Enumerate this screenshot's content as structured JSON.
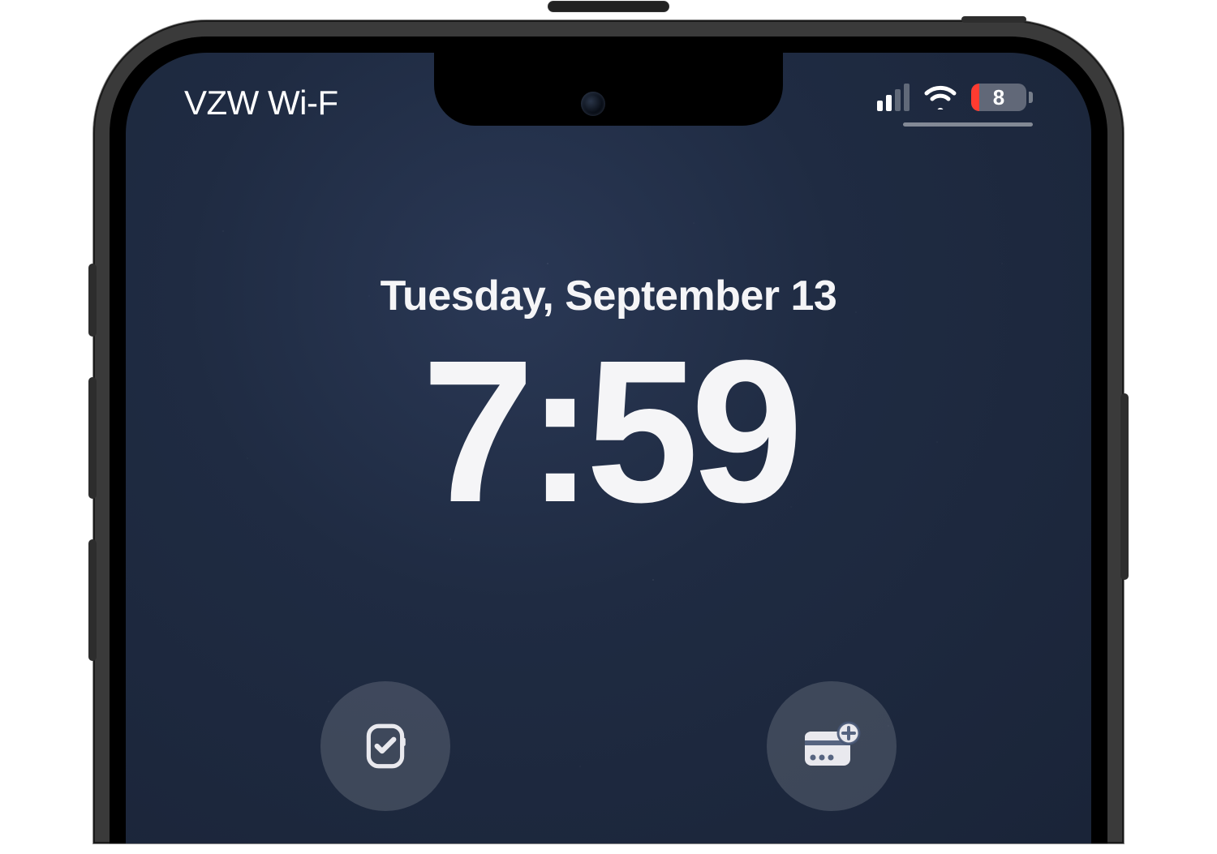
{
  "status_bar": {
    "carrier": "VZW Wi-F",
    "cellular_bars_active": 2,
    "cellular_bars_total": 4,
    "wifi_on": true,
    "battery_percent": "8",
    "battery_low": true,
    "battery_low_color": "#ff3b30"
  },
  "lock_screen": {
    "date": "Tuesday, September 13",
    "time": "7:59"
  },
  "widgets": {
    "left_icon": "reminders-watch-icon",
    "right_icon": "wallet-add-icon"
  }
}
